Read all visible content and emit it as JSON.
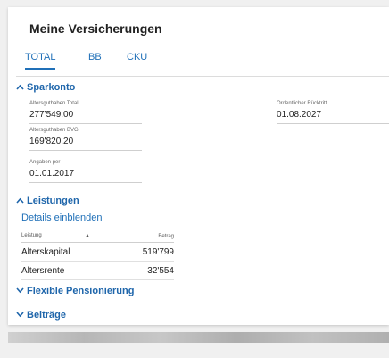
{
  "title": "Meine Versicherungen",
  "tabs": [
    {
      "label": "TOTAL",
      "active": true
    },
    {
      "label": "BB",
      "active": false
    },
    {
      "label": "CKU",
      "active": false
    }
  ],
  "sparkonto": {
    "heading": "Sparkonto",
    "alter_total_label": "Altersguthaben Total",
    "alter_total_value": "277'549.00",
    "ruecktritt_label": "Ordentlicher Rücktritt",
    "ruecktritt_value": "01.08.2027",
    "alter_bvg_label": "Altersguthaben BVG",
    "alter_bvg_value": "169'820.20",
    "angaben_label": "Angaben per",
    "angaben_value": "01.01.2017"
  },
  "leistungen": {
    "heading": "Leistungen",
    "details_link": "Details einblenden",
    "columns": [
      "Leistung",
      "Betrag"
    ],
    "rows": [
      {
        "name": "Alterskapital",
        "amount": "519'799"
      },
      {
        "name": "Altersrente",
        "amount": "32'554"
      }
    ]
  },
  "flexible": {
    "heading": "Flexible Pensionierung"
  },
  "beitraege": {
    "heading": "Beiträge"
  },
  "colors": {
    "accent": "#2070b8",
    "heading": "#1f66ab"
  }
}
